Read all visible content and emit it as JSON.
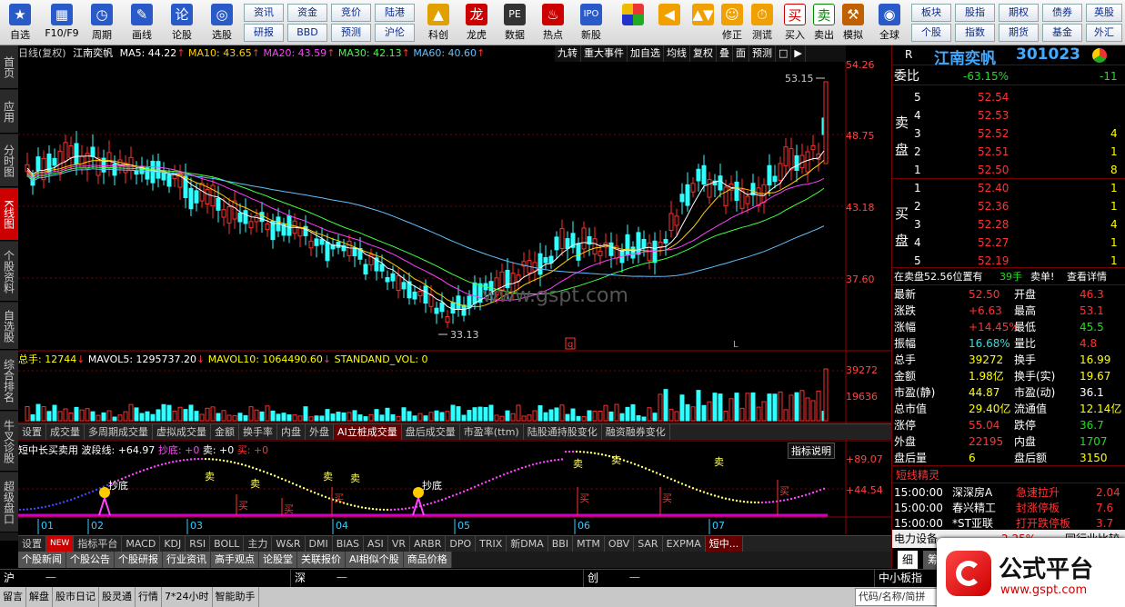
{
  "toolbar": {
    "big": [
      {
        "label": "自选",
        "icon": "star-icon",
        "color": "#2a5ac8"
      },
      {
        "label": "F10/F9",
        "icon": "f10-table-icon",
        "color": "#2a5ac8"
      },
      {
        "label": "周期",
        "icon": "clock-icon",
        "color": "#2a5ac8"
      },
      {
        "label": "画线",
        "icon": "pencil-icon",
        "color": "#2a5ac8"
      },
      {
        "label": "论股",
        "icon": "lun-icon",
        "color": "#2a5ac8"
      },
      {
        "label": "选股",
        "icon": "select-stock-icon",
        "color": "#2a5ac8"
      }
    ],
    "small_top": [
      "资讯",
      "资金",
      "竞价",
      "陆港"
    ],
    "small_bottom": [
      "研报",
      "BBD",
      "预测",
      "沪伦"
    ],
    "mid": [
      {
        "label": "科创",
        "icon": "chart-icon",
        "color": "#e0a000"
      },
      {
        "label": "龙虎",
        "icon": "dragon-icon",
        "color": "#c00"
      },
      {
        "label": "数据",
        "icon": "pe-icon",
        "color": "#333"
      },
      {
        "label": "热点",
        "icon": "hot-icon",
        "color": "#c00"
      },
      {
        "label": "新股",
        "icon": "ipo-icon",
        "color": "#2a5ac8"
      }
    ],
    "tools": [
      {
        "label": "",
        "icon": "grid-color-icon"
      },
      {
        "label": "",
        "icon": "arrow-left-icon"
      },
      {
        "label": "",
        "icon": "arrow-updown-icon"
      },
      {
        "label": "修正",
        "icon": "fix-icon"
      },
      {
        "label": "测谎",
        "icon": "stopwatch-icon"
      },
      {
        "label": "买入",
        "icon": "buy-icon"
      },
      {
        "label": "卖出",
        "icon": "sell-icon"
      },
      {
        "label": "模拟",
        "icon": "hammer-icon"
      },
      {
        "label": "全球",
        "icon": "globe-icon"
      }
    ],
    "right_top": [
      "板块",
      "股指",
      "期权",
      "债券",
      "英股"
    ],
    "right_bottom": [
      "个股",
      "指数",
      "期货",
      "基金",
      "外汇"
    ],
    "buy_char": "买",
    "sell_char": "卖"
  },
  "leftnav": [
    "首页",
    "应用",
    "分时图",
    "K线图",
    "个股资料",
    "自选股",
    "综合排名",
    "牛叉诊股",
    "超级盘口"
  ],
  "main": {
    "title": "日线(复权)",
    "name": "江南奕帆",
    "ma": [
      {
        "label": "MA5: 44.22",
        "color": "#ffffff"
      },
      {
        "label": "MA10: 43.65",
        "color": "#ffd000"
      },
      {
        "label": "MA20: 43.59",
        "color": "#ff40ff"
      },
      {
        "label": "MA30: 42.13",
        "color": "#40ff40"
      },
      {
        "label": "MA60: 40.60",
        "color": "#60c0ff"
      }
    ],
    "buttons": [
      "九转",
      "重大事件",
      "加自选",
      "均线",
      "复权",
      "叠",
      "面",
      "预测"
    ],
    "high_label": "53.15",
    "low_label": "33.13",
    "watermark": "www.gspt.com",
    "q_marker": "q",
    "l_marker": "L",
    "axis": [
      "54.26",
      "48.75",
      "43.18",
      "37.60"
    ]
  },
  "volume": {
    "title": "总手: 12744",
    "mav5": "MAVOL5: 1295737.20",
    "mav10": "MAVOL10: 1064490.60",
    "std": "STANDAND_VOL: 0",
    "axis": [
      "39272",
      "19636"
    ]
  },
  "tabsA": [
    "设置",
    "成交量",
    "多周期成交量",
    "虚拟成交量",
    "金额",
    "换手率",
    "内盘",
    "外盘",
    "AI立桩成交量",
    "盘后成交量",
    "市盈率(ttm)",
    "陆股通持股变化",
    "融资融券变化"
  ],
  "indicator": {
    "title": "短中长买卖用",
    "wave": "波段线: +64.97",
    "chaodi": "抄底: +0",
    "mai": "卖: +0",
    "mai2": "买: +0",
    "btn": "指标说明",
    "axis": [
      "+89.07",
      "+44.54"
    ],
    "lbl_chaodi": "抄底",
    "lbl_sell": "卖",
    "lbl_buy": "买"
  },
  "months": [
    "01",
    "02",
    "03",
    "04",
    "05",
    "06",
    "07"
  ],
  "tabsB": [
    "设置",
    "NEW",
    "指标平台",
    "MACD",
    "KDJ",
    "RSI",
    "BOLL",
    "主力",
    "W&R",
    "DMI",
    "BIAS",
    "ASI",
    "VR",
    "ARBR",
    "DPO",
    "TRIX",
    "新DMA",
    "BBI",
    "MTM",
    "OBV",
    "SAR",
    "EXPMA",
    "短中..."
  ],
  "tabsC": [
    "个股新闻",
    "个股公告",
    "个股研报",
    "行业资讯",
    "高手观点",
    "论股堂",
    "关联报价",
    "AI相似个股",
    "商品价格"
  ],
  "index": [
    {
      "name": "沪",
      "val": "一"
    },
    {
      "name": "深",
      "val": "一"
    },
    {
      "name": "创",
      "val": "一"
    },
    {
      "name": "中小板指",
      "val": ""
    }
  ],
  "status": [
    "留言",
    "解盘",
    "股市日记",
    "股灵通",
    "行情",
    "7*24小时",
    "智能助手",
    "代码/名称/简拼"
  ],
  "right": {
    "r": "R",
    "name": "江南奕帆",
    "code": "301023",
    "weibi": "委比",
    "weibi_val": "-63.15%",
    "weibi_diff": "-11",
    "sell_lbl": "卖盘",
    "buy_lbl": "买盘",
    "sell": [
      {
        "n": "5",
        "p": "52.54",
        "v": ""
      },
      {
        "n": "4",
        "p": "52.53",
        "v": ""
      },
      {
        "n": "3",
        "p": "52.52",
        "v": "4"
      },
      {
        "n": "2",
        "p": "52.51",
        "v": "1"
      },
      {
        "n": "1",
        "p": "52.50",
        "v": "8"
      }
    ],
    "buy": [
      {
        "n": "1",
        "p": "52.40",
        "v": "1"
      },
      {
        "n": "2",
        "p": "52.36",
        "v": "1"
      },
      {
        "n": "3",
        "p": "52.28",
        "v": "4"
      },
      {
        "n": "4",
        "p": "52.27",
        "v": "1"
      },
      {
        "n": "5",
        "p": "52.19",
        "v": "1"
      }
    ],
    "trade": "在卖盘52.56位置有",
    "trade_v": "39手",
    "trade_s": "卖单!",
    "trade_d": "查看详情",
    "stats": [
      [
        "最新",
        "52.50",
        "red",
        "开盘",
        "46.3",
        "red"
      ],
      [
        "涨跌",
        "+6.63",
        "red",
        "最高",
        "53.1",
        "red"
      ],
      [
        "涨幅",
        "+14.45%",
        "red",
        "最低",
        "45.5",
        "grn"
      ],
      [
        "振幅",
        "16.68%",
        "cyan",
        "量比",
        "4.8",
        "red"
      ],
      [
        "总手",
        "39272",
        "yel",
        "换手",
        "16.99",
        "yel"
      ],
      [
        "金额",
        "1.98亿",
        "yel",
        "换手(实)",
        "19.67",
        "yel"
      ],
      [
        "市盈(静)",
        "44.87",
        "yel",
        "市盈(动)",
        "36.1",
        "wht"
      ],
      [
        "总市值",
        "29.40亿",
        "yel",
        "流通值",
        "12.14亿",
        "yel"
      ],
      [
        "涨停",
        "55.04",
        "red",
        "跌停",
        "36.7",
        "grn"
      ],
      [
        "外盘",
        "22195",
        "red",
        "内盘",
        "1707",
        "grn"
      ],
      [
        "盘后量",
        "6",
        "yel",
        "盘后额",
        "3150",
        "yel"
      ]
    ],
    "sprite": "短线精灵",
    "sprite_rows": [
      [
        "15:00:00",
        "深深房A",
        "急速拉升",
        "2.04"
      ],
      [
        "15:00:00",
        "春兴精工",
        "封涨停板",
        "7.6"
      ],
      [
        "15:00:00",
        "*ST亚联",
        "打开跌停板",
        "3.7"
      ]
    ],
    "sector": "电力设备",
    "sector_pct": "2.25%",
    "sector_cmp": "同行业比较",
    "tab_xi": "细",
    "tab_zhu": "筹"
  },
  "logo": {
    "brand": "公式平台",
    "url": "www.gspt.com"
  }
}
